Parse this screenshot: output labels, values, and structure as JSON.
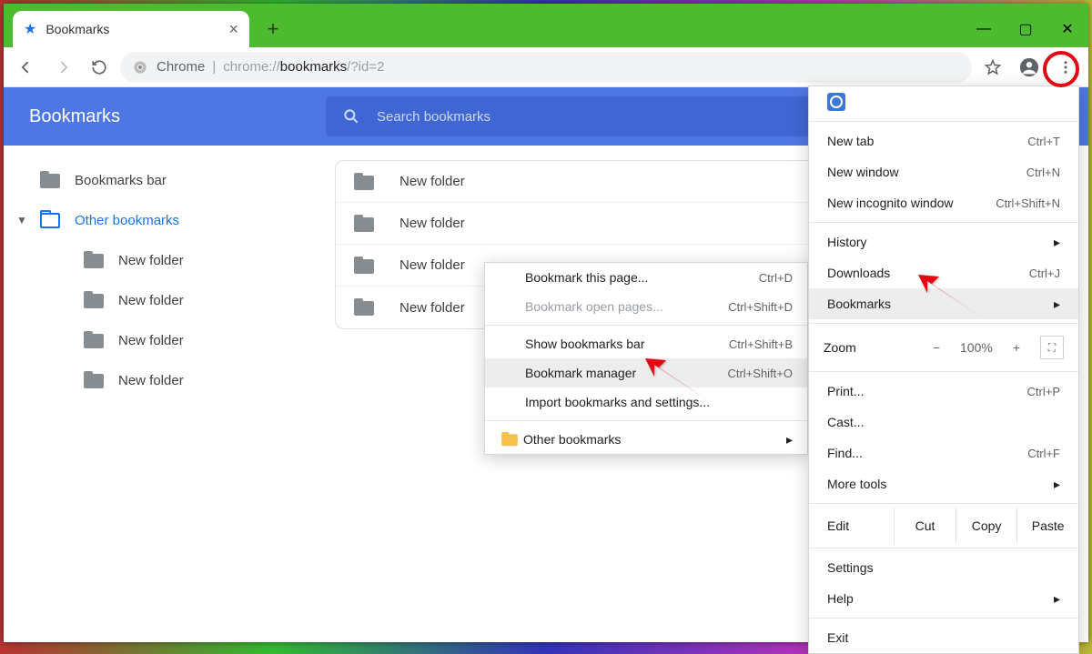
{
  "tab": {
    "title": "Bookmarks"
  },
  "address": {
    "scheme": "Chrome",
    "prefix": "chrome://",
    "bold": "bookmarks",
    "suffix": "/?id=2"
  },
  "page": {
    "title": "Bookmarks",
    "search_placeholder": "Search bookmarks"
  },
  "sidebar": {
    "items": [
      {
        "label": "Bookmarks bar"
      },
      {
        "label": "Other bookmarks"
      }
    ],
    "children": [
      {
        "label": "New folder"
      },
      {
        "label": "New folder"
      },
      {
        "label": "New folder"
      },
      {
        "label": "New folder"
      }
    ]
  },
  "content_rows": [
    {
      "label": "New folder"
    },
    {
      "label": "New folder"
    },
    {
      "label": "New folder"
    },
    {
      "label": "New folder"
    }
  ],
  "submenu": {
    "items": [
      {
        "label": "Bookmark this page...",
        "shortcut": "Ctrl+D"
      },
      {
        "label": "Bookmark open pages...",
        "shortcut": "Ctrl+Shift+D",
        "disabled": true
      },
      {
        "sep": true
      },
      {
        "label": "Show bookmarks bar",
        "shortcut": "Ctrl+Shift+B"
      },
      {
        "label": "Bookmark manager",
        "shortcut": "Ctrl+Shift+O",
        "hover": true
      },
      {
        "label": "Import bookmarks and settings..."
      },
      {
        "sep": true
      },
      {
        "label": "Other bookmarks",
        "icon": "folder",
        "submenu": true
      }
    ]
  },
  "mainmenu": {
    "new_tab": "New tab",
    "new_tab_s": "Ctrl+T",
    "new_window": "New window",
    "new_window_s": "Ctrl+N",
    "new_incognito": "New incognito window",
    "new_incognito_s": "Ctrl+Shift+N",
    "history": "History",
    "downloads": "Downloads",
    "downloads_s": "Ctrl+J",
    "bookmarks": "Bookmarks",
    "zoom_label": "Zoom",
    "zoom_value": "100%",
    "print": "Print...",
    "print_s": "Ctrl+P",
    "cast": "Cast...",
    "find": "Find...",
    "find_s": "Ctrl+F",
    "more_tools": "More tools",
    "edit": "Edit",
    "cut": "Cut",
    "copy": "Copy",
    "paste": "Paste",
    "settings": "Settings",
    "help": "Help",
    "exit": "Exit"
  }
}
